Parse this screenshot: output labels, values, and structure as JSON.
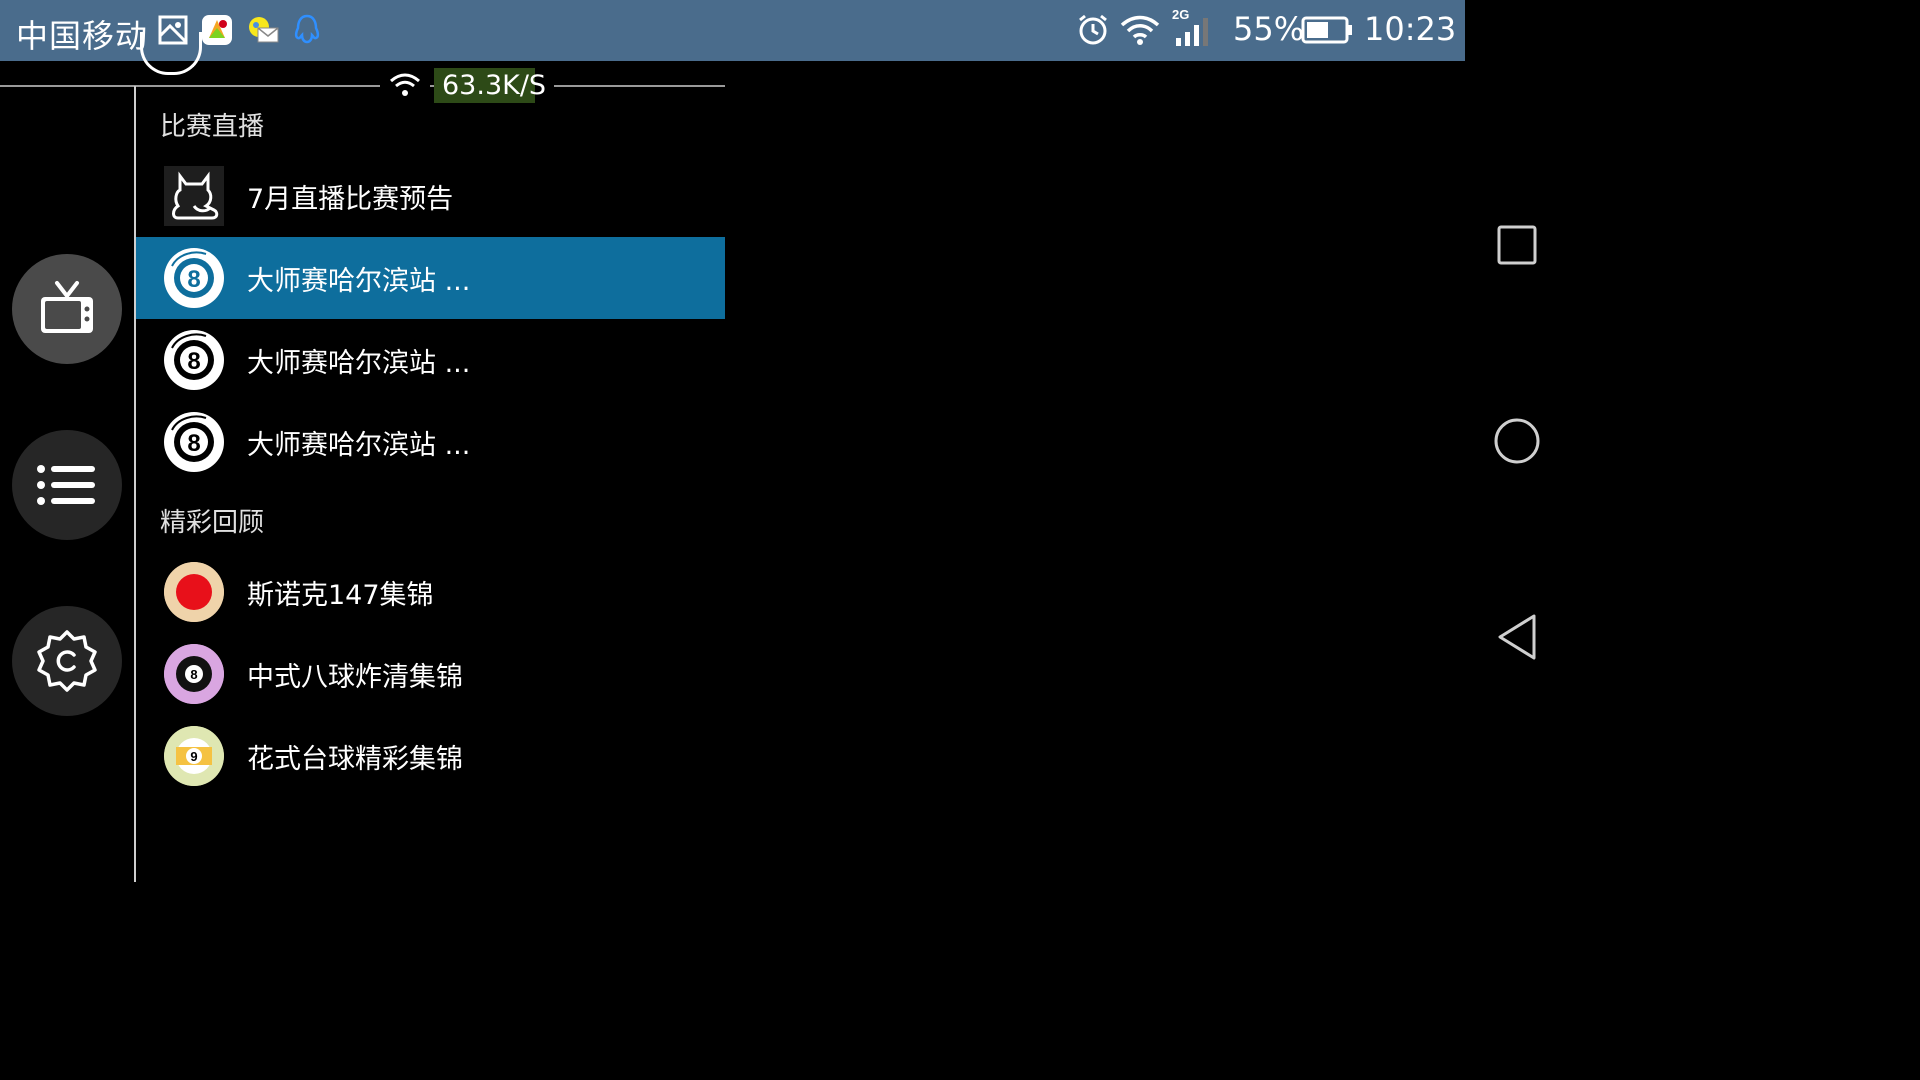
{
  "status_bar": {
    "carrier": "中国移动",
    "network_type": "2G",
    "battery": "55%",
    "time": "10:23"
  },
  "network_speed": "63.3K/S",
  "sections": [
    {
      "title": "比赛直播",
      "items": [
        {
          "label": "7月直播比赛预告",
          "icon": "cat-logo-icon",
          "selected": false
        },
        {
          "label": "大师赛哈尔滨站 ...",
          "icon": "eight-ball-icon",
          "selected": true
        },
        {
          "label": "大师赛哈尔滨站 ...",
          "icon": "eight-ball-icon",
          "selected": false
        },
        {
          "label": "大师赛哈尔滨站 ...",
          "icon": "eight-ball-icon",
          "selected": false
        }
      ]
    },
    {
      "title": "精彩回顾",
      "items": [
        {
          "label": "斯诺克147集锦",
          "icon": "red-ball-icon",
          "selected": false
        },
        {
          "label": "中式八球炸清集锦",
          "icon": "purple-eight-ball-icon",
          "selected": false
        },
        {
          "label": "花式台球精彩集锦",
          "icon": "nine-ball-icon",
          "selected": false
        }
      ]
    }
  ],
  "colors": {
    "status_bar": "#4a6c8c",
    "selected_row": "#0e6e9d",
    "speed_badge": "#2d4a17"
  }
}
